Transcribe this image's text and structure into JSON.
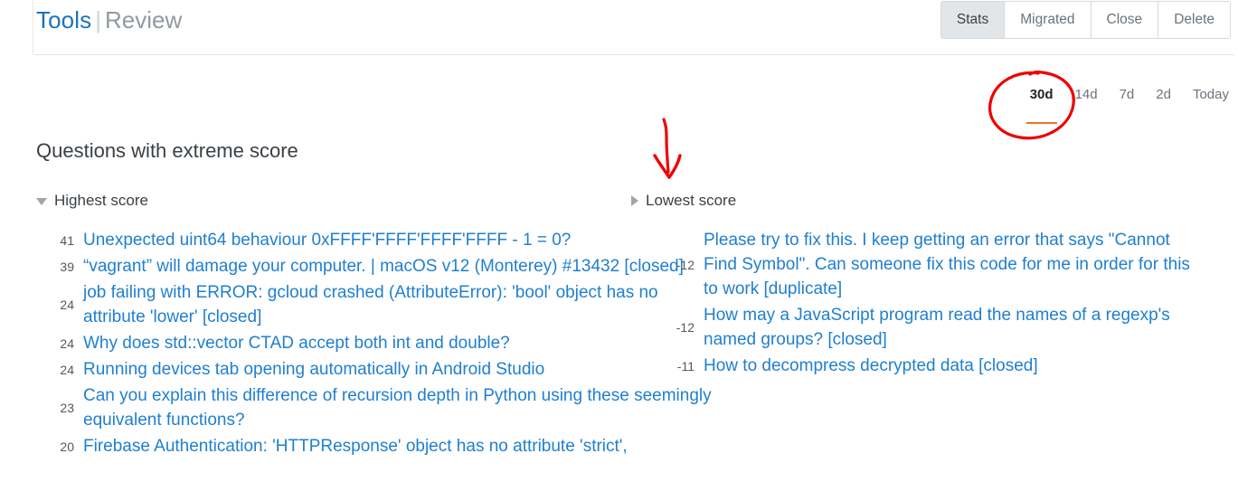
{
  "header": {
    "brand_primary": "Tools",
    "brand_separator": "|",
    "brand_secondary": "Review",
    "buttons": [
      {
        "label": "Stats",
        "selected": true
      },
      {
        "label": "Migrated",
        "selected": false
      },
      {
        "label": "Close",
        "selected": false
      },
      {
        "label": "Delete",
        "selected": false
      }
    ]
  },
  "period_tabs": [
    {
      "label": "30d",
      "active": true
    },
    {
      "label": "14d",
      "active": false
    },
    {
      "label": "7d",
      "active": false
    },
    {
      "label": "2d",
      "active": false
    },
    {
      "label": "Today",
      "active": false
    }
  ],
  "section": {
    "title": "Questions with extreme score"
  },
  "columns": {
    "highest": {
      "heading": "Highest score",
      "expanded": true,
      "items": [
        {
          "score": "41",
          "title": "Unexpected uint64 behaviour 0xFFFF'FFFF'FFFF'FFFF - 1 = 0?"
        },
        {
          "score": "39",
          "title": "“vagrant” will damage your computer. | macOS v12 (Monterey) #13432 [closed]"
        },
        {
          "score": "24",
          "title": "job failing with ERROR: gcloud crashed (AttributeError): 'bool' object has no attribute 'lower' [closed]"
        },
        {
          "score": "24",
          "title": "Why does std::vector CTAD accept both int and double?"
        },
        {
          "score": "24",
          "title": "Running devices tab opening automatically in Android Studio"
        },
        {
          "score": "23",
          "title": "Can you explain this difference of recursion depth in Python using these seemingly equivalent functions?"
        },
        {
          "score": "20",
          "title": "Firebase Authentication: 'HTTPResponse' object has no attribute 'strict',"
        }
      ]
    },
    "lowest": {
      "heading": "Lowest score",
      "expanded": false,
      "items": [
        {
          "score": "-12",
          "title": "Please try to fix this. I keep getting an error that says \"Cannot Find Symbol\". Can someone fix this code for me in order for this to work [duplicate]"
        },
        {
          "score": "-12",
          "title": "How may a JavaScript program read the names of a regexp's named groups? [closed]"
        },
        {
          "score": "-11",
          "title": "How to decompress decrypted data [closed]"
        }
      ]
    }
  },
  "annotations": {
    "circle_color": "#ee0000",
    "arrow_color": "#ee0000",
    "circle_target": "30d",
    "arrow_target": "Lowest score"
  },
  "colors": {
    "link": "#1f7fd0",
    "accent_orange": "#e87722",
    "text": "#3b4045",
    "muted": "#6a737c"
  }
}
